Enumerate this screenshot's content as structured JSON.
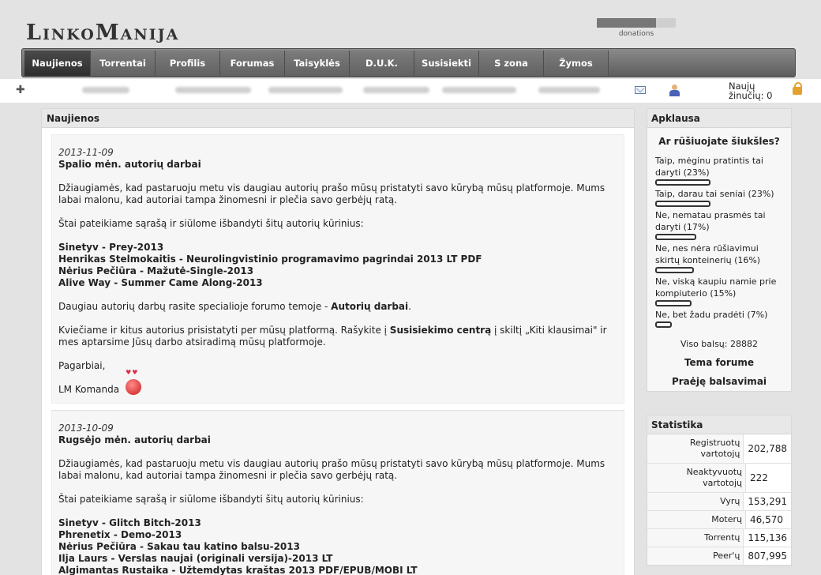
{
  "header": {
    "logo": "LinkoManija",
    "donations_label": "donations",
    "donations_progress": 0.75
  },
  "nav": {
    "items": [
      "Naujienos",
      "Torrentai",
      "Profilis",
      "Forumas",
      "Taisyklės",
      "D.U.K.",
      "Susisiekti",
      "S zona",
      "Žymos"
    ]
  },
  "userbar": {
    "messages_label": "Naujų žinučių: 0"
  },
  "main": {
    "title": "Naujienos",
    "news": [
      {
        "date": "2013-11-09",
        "title": "Spalio mėn. autorių darbai",
        "intro": "Džiaugiamės, kad pastaruoju metu vis daugiau autorių prašo mūsų pristatyti savo kūrybą mūsų platformoje. Mums labai malonu, kad autoriai tampa žinomesni ir plečia savo gerbėjų ratą.",
        "lead": "Štai pateikiame sąrašą ir siūlome išbandyti šitų autorių kūrinius:",
        "works": [
          "Sinetyv - Prey-2013",
          "Henrikas Stelmokaitis - Neurolingvistinio programavimo pagrindai 2013 LT PDF",
          "Nėrius Pečiūra - Mažutė-Single-2013",
          "Alive Way - Summer Came Along-2013"
        ],
        "more_pre": "Daugiau autorių darbų rasite specialioje forumo temoje - ",
        "more_link": "Autorių darbai",
        "more_post": ".",
        "invite_pre": "Kviečiame ir kitus autorius prisistatyti per mūsų platformą. Rašykite į ",
        "invite_link": "Susisiekimo centrą",
        "invite_post": " į skiltį „Kiti klausimai\" ir mes aptarsime Jūsų darbo atsiradimą mūsų platformoje.",
        "greeting": "Pagarbiai,",
        "signature": "LM Komanda"
      },
      {
        "date": "2013-10-09",
        "title": "Rugsėjo mėn. autorių darbai",
        "intro": "Džiaugiamės, kad pastaruoju metu vis daugiau autorių prašo mūsų pristatyti savo kūrybą mūsų platformoje. Mums labai malonu, kad autoriai tampa žinomesni ir plečia savo gerbėjų ratą.",
        "lead": "Štai pateikiame sąrašą ir siūlome išbandyti šitų autorių kūrinius:",
        "works": [
          "Sinetyv - Glitch Bitch-2013",
          "Phrenetix - Demo-2013",
          "Nėrius Pečiūra - Sakau tau katino balsu-2013",
          "Ilja Laurs - Verslas naujai (originali versija)-2013 LT",
          "Algimantas Rustaika - Užtemdytas kraštas 2013 PDF/EPUB/MOBI LT"
        ]
      }
    ]
  },
  "poll": {
    "title": "Apklausa",
    "question": "Ar rūšiuojate šiukšles?",
    "options": [
      {
        "label": "Taip, mėginu pratintis tai daryti (23%)",
        "percent": 23
      },
      {
        "label": "Taip, darau tai seniai (23%)",
        "percent": 23
      },
      {
        "label": "Ne, nematau prasmės tai daryti (17%)",
        "percent": 17
      },
      {
        "label": "Ne, nes nėra rūšiavimui skirtų konteinerių (16%)",
        "percent": 16
      },
      {
        "label": "Ne, viską kaupiu namie prie kompiuterio (15%)",
        "percent": 15
      },
      {
        "label": "Ne, bet žadu pradėti (7%)",
        "percent": 7
      }
    ],
    "total": "Viso balsų: 28882",
    "forum_link": "Tema forume",
    "past_link": "Praėję balsavimai"
  },
  "stats": {
    "title": "Statistika",
    "rows": [
      {
        "k": "Registruotų vartotojų",
        "v": "202,788"
      },
      {
        "k": "Neaktyvuotų vartotojų",
        "v": "222"
      },
      {
        "k": "Vyrų",
        "v": "153,291"
      },
      {
        "k": "Moterų",
        "v": "46,570"
      },
      {
        "k": "Torrentų",
        "v": "115,136"
      },
      {
        "k": "Peer'ų",
        "v": "807,995"
      }
    ]
  }
}
